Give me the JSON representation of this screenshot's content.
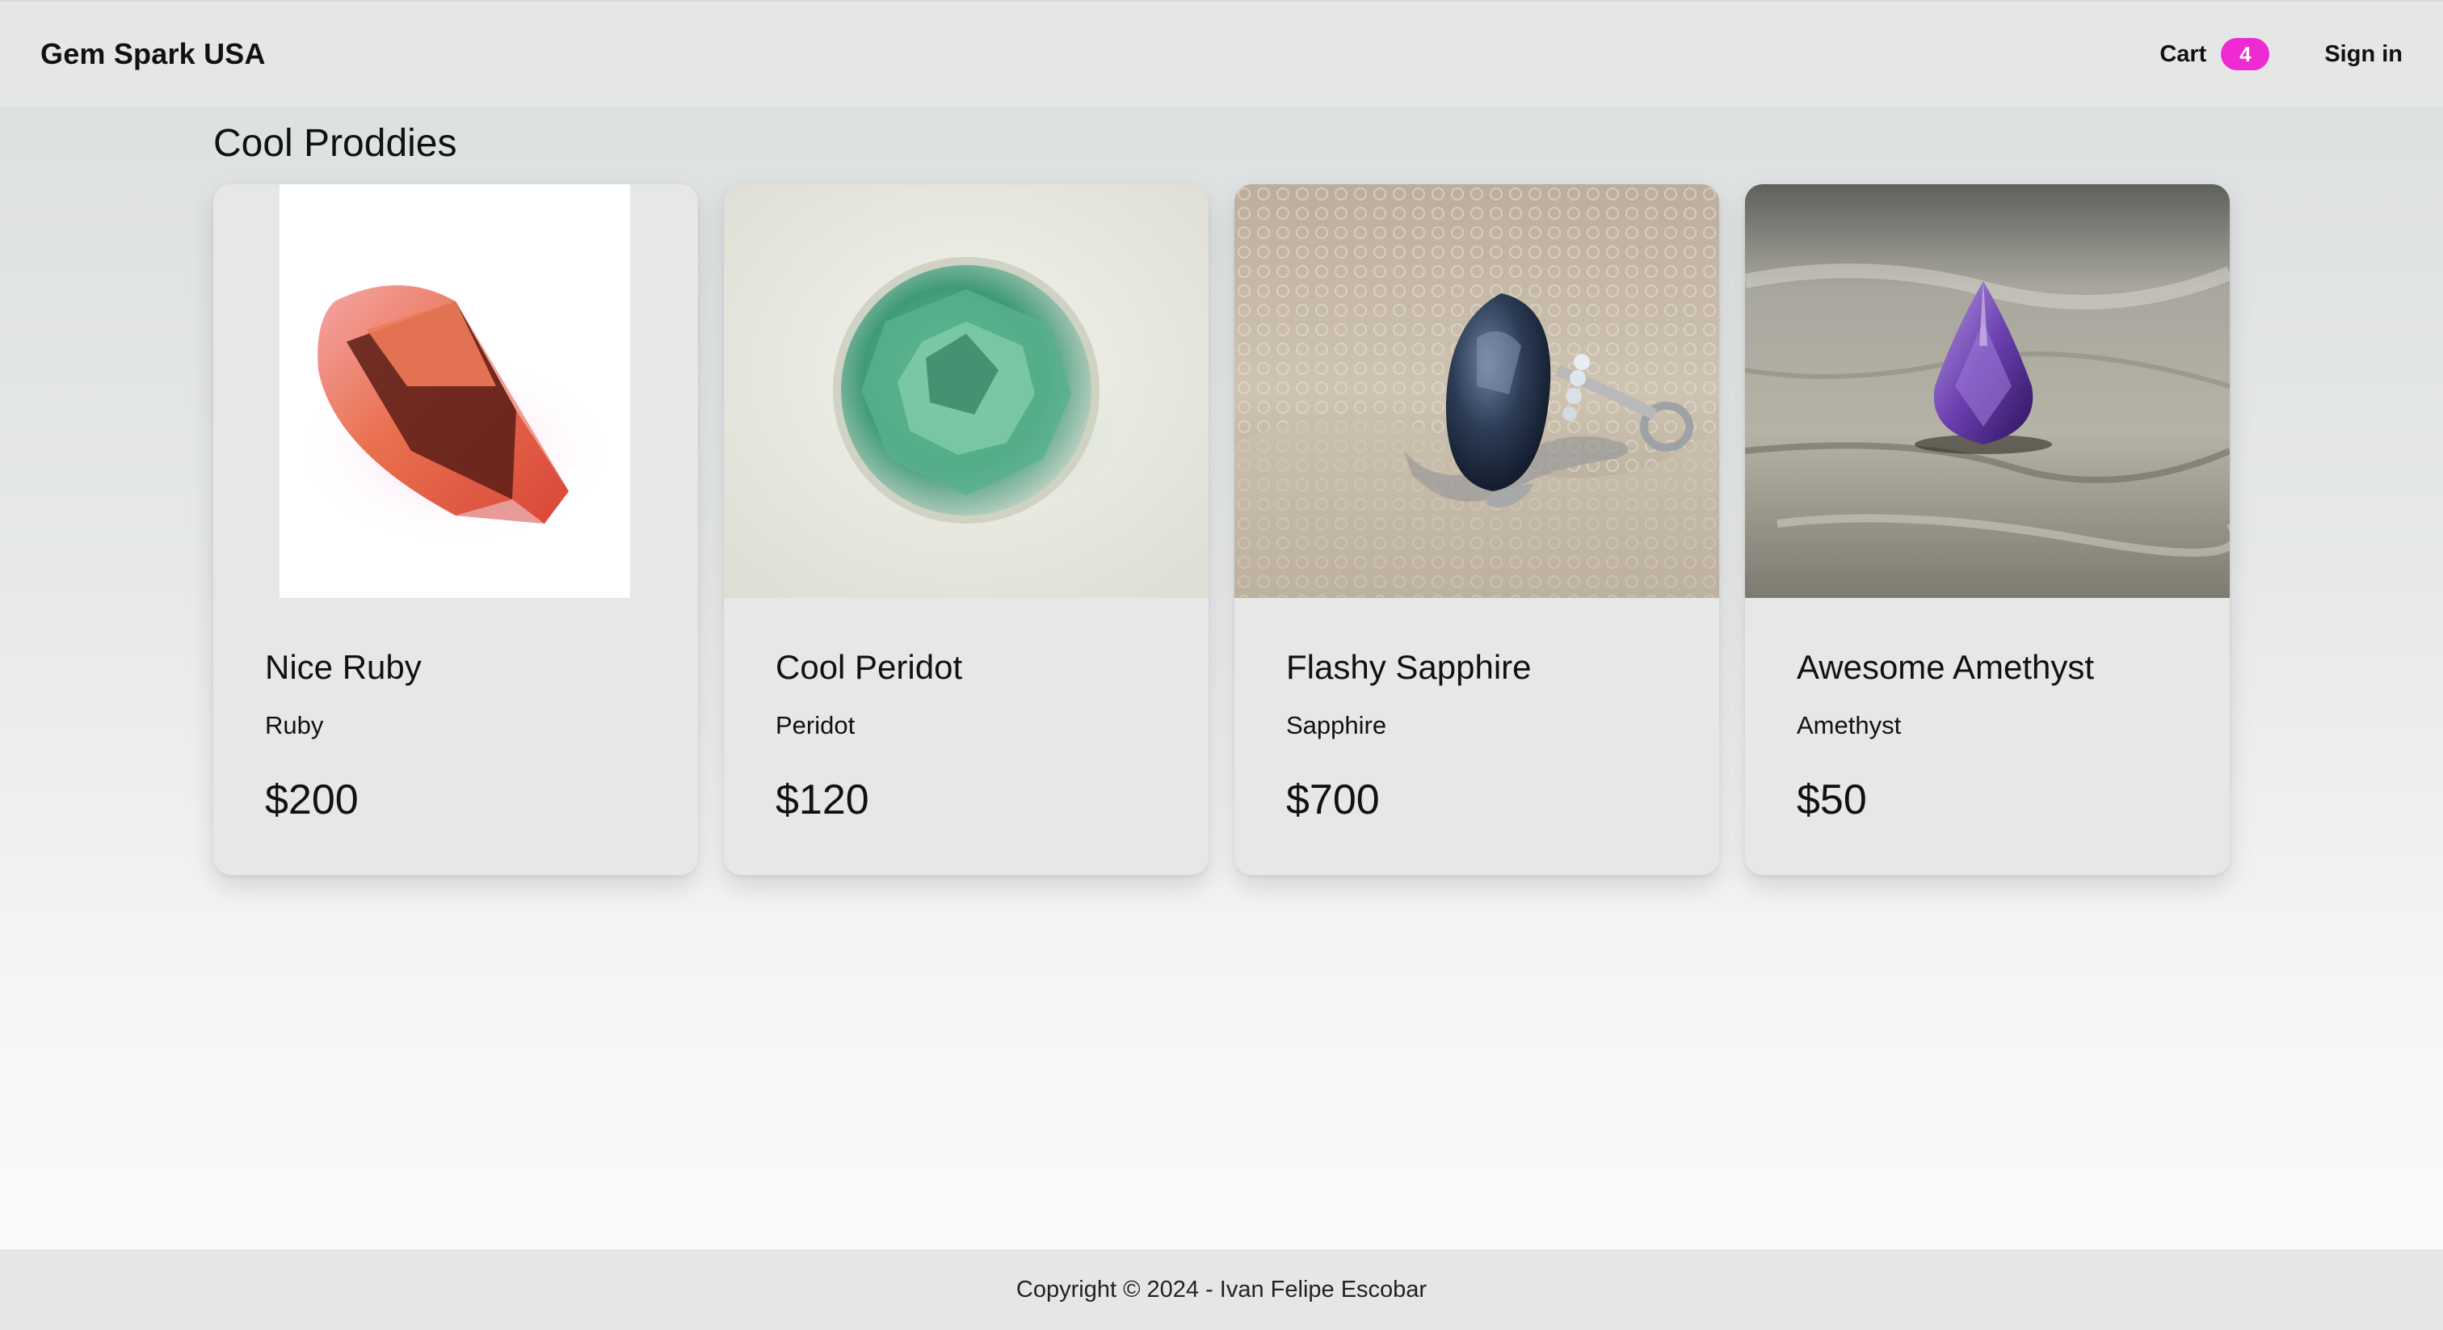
{
  "navbar": {
    "brand": "Gem Spark USA",
    "cart_label": "Cart",
    "cart_count": "4",
    "signin_label": "Sign in"
  },
  "section": {
    "title": "Cool Proddies"
  },
  "products": [
    {
      "name": "Nice Ruby",
      "category": "Ruby",
      "price": "$200",
      "image": "ruby-image"
    },
    {
      "name": "Cool Peridot",
      "category": "Peridot",
      "price": "$120",
      "image": "peridot-image"
    },
    {
      "name": "Flashy Sapphire",
      "category": "Sapphire",
      "price": "$700",
      "image": "sapphire-ring-image"
    },
    {
      "name": "Awesome Amethyst",
      "category": "Amethyst",
      "price": "$50",
      "image": "amethyst-image"
    }
  ],
  "footer": {
    "text": "Copyright © 2024 - Ivan Felipe Escobar"
  },
  "colors": {
    "badge": "#ee2bd2",
    "navbar": "#e5e7e7",
    "card": "#e6e7e6"
  }
}
